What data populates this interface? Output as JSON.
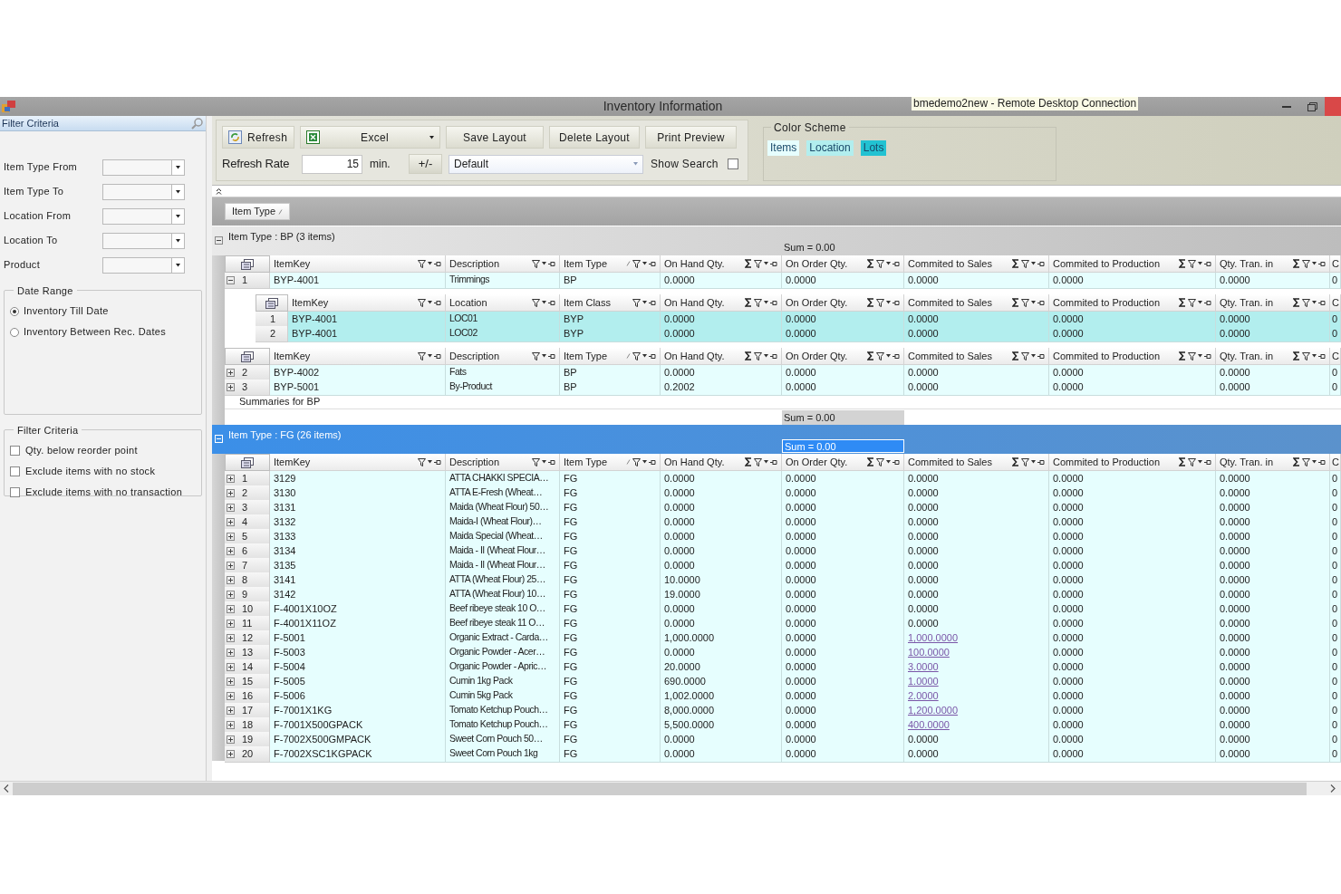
{
  "window": {
    "title": "Inventory Information",
    "remote_title": "bmedemo2new - Remote Desktop Connection"
  },
  "filter_panel": {
    "title": "Filter Criteria",
    "fields": [
      {
        "label": "Item Type From"
      },
      {
        "label": "Item Type To"
      },
      {
        "label": "Location From"
      },
      {
        "label": "Location To"
      },
      {
        "label": "Product"
      }
    ],
    "date_range": {
      "title": "Date Range",
      "options": [
        {
          "label": "Inventory Till Date",
          "selected": true
        },
        {
          "label": "Inventory Between Rec. Dates",
          "selected": false
        }
      ]
    },
    "criteria": {
      "title": "Filter Criteria",
      "options": [
        {
          "label": "Qty. below reorder point",
          "checked": false
        },
        {
          "label": "Exclude items with no stock",
          "checked": false
        },
        {
          "label": "Exclude items with no transaction",
          "checked": false
        }
      ]
    }
  },
  "toolbar": {
    "refresh": "Refresh",
    "excel": "Excel",
    "save_layout": "Save Layout",
    "delete_layout": "Delete Layout",
    "print_preview": "Print Preview",
    "refresh_rate": {
      "label": "Refresh Rate",
      "value": "15",
      "unit": "min."
    },
    "adjust": "+/-",
    "layout": "Default",
    "show_search": {
      "label": "Show Search",
      "checked": false
    }
  },
  "color_scheme": {
    "title": "Color Scheme",
    "items": [
      {
        "label": "Items",
        "color": "#e6fefe"
      },
      {
        "label": "Location",
        "color": "#b2eeee"
      },
      {
        "label": "Lots",
        "color": "#22c2d2"
      }
    ]
  },
  "group_by": {
    "label": "Item Type",
    "sorted": true
  },
  "groups": [
    {
      "label": "Item Type : BP (3 items)",
      "sum": "Sum = 0.00",
      "expanded": true,
      "selected": false,
      "summary_label": "Summaries for BP",
      "summary_sum": "Sum = 0.00",
      "blocks": [
        {
          "kind": "header",
          "columns": [
            {
              "label": "ItemKey",
              "kind": "text",
              "sorted": false
            },
            {
              "label": "Description",
              "kind": "text",
              "sorted": false
            },
            {
              "label": "Item Type",
              "kind": "text",
              "sorted": true
            },
            {
              "label": "On Hand Qty.",
              "kind": "numeric",
              "sorted": false
            },
            {
              "label": "On Order Qty.",
              "kind": "numeric",
              "sorted": false
            },
            {
              "label": "Commited to Sales",
              "kind": "numeric",
              "sorted": false
            },
            {
              "label": "Commited to Production",
              "kind": "numeric",
              "sorted": false
            },
            {
              "label": "Qty. Tran. in",
              "kind": "numeric",
              "sorted": false
            },
            {
              "label": "C",
              "kind": "partial",
              "sorted": false
            }
          ]
        },
        {
          "kind": "row",
          "number": "1",
          "expanded": true,
          "sales_link": false,
          "cells": [
            "BYP-4001",
            "Trimmings",
            "BP",
            "0.0000",
            "0.0000",
            "0.0000",
            "0.0000",
            "0.0000",
            "0"
          ]
        },
        {
          "kind": "child_table",
          "columns": [
            {
              "label": "ItemKey",
              "kind": "text",
              "sorted": false
            },
            {
              "label": "Location",
              "kind": "text",
              "sorted": false
            },
            {
              "label": "Item Class",
              "kind": "text",
              "sorted": false
            },
            {
              "label": "On Hand Qty.",
              "kind": "numeric",
              "sorted": false
            },
            {
              "label": "On Order Qty.",
              "kind": "numeric",
              "sorted": false
            },
            {
              "label": "Commited to Sales",
              "kind": "numeric",
              "sorted": false
            },
            {
              "label": "Commited to Production",
              "kind": "numeric",
              "sorted": false
            },
            {
              "label": "Qty. Tran. in",
              "kind": "numeric",
              "sorted": false
            },
            {
              "label": "C",
              "kind": "partial",
              "sorted": false
            }
          ],
          "rows": [
            {
              "number": "1",
              "cells": [
                "BYP-4001",
                "LOC01",
                "BYP",
                "0.0000",
                "0.0000",
                "0.0000",
                "0.0000",
                "0.0000",
                "0"
              ]
            },
            {
              "number": "2",
              "cells": [
                "BYP-4001",
                "LOC02",
                "BYP",
                "0.0000",
                "0.0000",
                "0.0000",
                "0.0000",
                "0.0000",
                "0"
              ]
            }
          ]
        },
        {
          "kind": "header",
          "columns": [
            {
              "label": "ItemKey",
              "kind": "text",
              "sorted": false
            },
            {
              "label": "Description",
              "kind": "text",
              "sorted": false
            },
            {
              "label": "Item Type",
              "kind": "text",
              "sorted": true
            },
            {
              "label": "On Hand Qty.",
              "kind": "numeric",
              "sorted": false
            },
            {
              "label": "On Order Qty.",
              "kind": "numeric",
              "sorted": false
            },
            {
              "label": "Commited to Sales",
              "kind": "numeric",
              "sorted": false
            },
            {
              "label": "Commited to Production",
              "kind": "numeric",
              "sorted": false
            },
            {
              "label": "Qty. Tran. in",
              "kind": "numeric",
              "sorted": false
            },
            {
              "label": "C",
              "kind": "partial",
              "sorted": false
            }
          ]
        },
        {
          "kind": "row",
          "number": "2",
          "expanded": false,
          "sales_link": false,
          "cells": [
            "BYP-4002",
            "Fats",
            "BP",
            "0.0000",
            "0.0000",
            "0.0000",
            "0.0000",
            "0.0000",
            "0"
          ]
        },
        {
          "kind": "row",
          "number": "3",
          "expanded": false,
          "sales_link": false,
          "cells": [
            "BYP-5001",
            "By-Product",
            "BP",
            "0.2002",
            "0.0000",
            "0.0000",
            "0.0000",
            "0.0000",
            "0"
          ]
        }
      ]
    },
    {
      "label": "Item Type : FG (26 items)",
      "sum": "Sum = 0.00",
      "expanded": true,
      "selected": true,
      "blocks": [
        {
          "kind": "header",
          "columns": [
            {
              "label": "ItemKey",
              "kind": "text",
              "sorted": false
            },
            {
              "label": "Description",
              "kind": "text",
              "sorted": false
            },
            {
              "label": "Item Type",
              "kind": "text",
              "sorted": true
            },
            {
              "label": "On Hand Qty.",
              "kind": "numeric",
              "sorted": false
            },
            {
              "label": "On Order Qty.",
              "kind": "numeric",
              "sorted": false
            },
            {
              "label": "Commited to Sales",
              "kind": "numeric",
              "sorted": false
            },
            {
              "label": "Commited to Production",
              "kind": "numeric",
              "sorted": false
            },
            {
              "label": "Qty. Tran. in",
              "kind": "numeric",
              "sorted": false
            },
            {
              "label": "C",
              "kind": "partial",
              "sorted": false
            }
          ]
        },
        {
          "kind": "row",
          "number": "1",
          "expanded": false,
          "sales_link": false,
          "cells": [
            "3129",
            "ATTA CHAKKI SPECIA…",
            "FG",
            "0.0000",
            "0.0000",
            "0.0000",
            "0.0000",
            "0.0000",
            "0"
          ]
        },
        {
          "kind": "row",
          "number": "2",
          "expanded": false,
          "sales_link": false,
          "cells": [
            "3130",
            "ATTA E-Fresh (Wheat…",
            "FG",
            "0.0000",
            "0.0000",
            "0.0000",
            "0.0000",
            "0.0000",
            "0"
          ]
        },
        {
          "kind": "row",
          "number": "3",
          "expanded": false,
          "sales_link": false,
          "cells": [
            "3131",
            "Maida (Wheat Flour) 50…",
            "FG",
            "0.0000",
            "0.0000",
            "0.0000",
            "0.0000",
            "0.0000",
            "0"
          ]
        },
        {
          "kind": "row",
          "number": "4",
          "expanded": false,
          "sales_link": false,
          "cells": [
            "3132",
            "Maida-I (Wheat Flour)…",
            "FG",
            "0.0000",
            "0.0000",
            "0.0000",
            "0.0000",
            "0.0000",
            "0"
          ]
        },
        {
          "kind": "row",
          "number": "5",
          "expanded": false,
          "sales_link": false,
          "cells": [
            "3133",
            "Maida Special (Wheat…",
            "FG",
            "0.0000",
            "0.0000",
            "0.0000",
            "0.0000",
            "0.0000",
            "0"
          ]
        },
        {
          "kind": "row",
          "number": "6",
          "expanded": false,
          "sales_link": false,
          "cells": [
            "3134",
            "Maida - II (Wheat Flour…",
            "FG",
            "0.0000",
            "0.0000",
            "0.0000",
            "0.0000",
            "0.0000",
            "0"
          ]
        },
        {
          "kind": "row",
          "number": "7",
          "expanded": false,
          "sales_link": false,
          "cells": [
            "3135",
            "Maida - II (Wheat Flour…",
            "FG",
            "0.0000",
            "0.0000",
            "0.0000",
            "0.0000",
            "0.0000",
            "0"
          ]
        },
        {
          "kind": "row",
          "number": "8",
          "expanded": false,
          "sales_link": false,
          "cells": [
            "3141",
            "ATTA (Wheat Flour) 25…",
            "FG",
            "10.0000",
            "0.0000",
            "0.0000",
            "0.0000",
            "0.0000",
            "0"
          ]
        },
        {
          "kind": "row",
          "number": "9",
          "expanded": false,
          "sales_link": false,
          "cells": [
            "3142",
            "ATTA (Wheat Flour) 10…",
            "FG",
            "19.0000",
            "0.0000",
            "0.0000",
            "0.0000",
            "0.0000",
            "0"
          ]
        },
        {
          "kind": "row",
          "number": "10",
          "expanded": false,
          "sales_link": false,
          "cells": [
            "F-4001X10OZ",
            "Beef ribeye steak 10 O…",
            "FG",
            "0.0000",
            "0.0000",
            "0.0000",
            "0.0000",
            "0.0000",
            "0"
          ]
        },
        {
          "kind": "row",
          "number": "11",
          "expanded": false,
          "sales_link": false,
          "cells": [
            "F-4001X11OZ",
            "Beef ribeye steak 11 O…",
            "FG",
            "0.0000",
            "0.0000",
            "0.0000",
            "0.0000",
            "0.0000",
            "0"
          ]
        },
        {
          "kind": "row",
          "number": "12",
          "expanded": false,
          "sales_link": true,
          "cells": [
            "F-5001",
            "Organic Extract - Carda…",
            "FG",
            "1,000.0000",
            "0.0000",
            "1,000.0000",
            "0.0000",
            "0.0000",
            "0"
          ]
        },
        {
          "kind": "row",
          "number": "13",
          "expanded": false,
          "sales_link": true,
          "cells": [
            "F-5003",
            "Organic Powder - Acer…",
            "FG",
            "0.0000",
            "0.0000",
            "100.0000",
            "0.0000",
            "0.0000",
            "0"
          ]
        },
        {
          "kind": "row",
          "number": "14",
          "expanded": false,
          "sales_link": true,
          "cells": [
            "F-5004",
            "Organic Powder - Apric…",
            "FG",
            "20.0000",
            "0.0000",
            "3.0000",
            "0.0000",
            "0.0000",
            "0"
          ]
        },
        {
          "kind": "row",
          "number": "15",
          "expanded": false,
          "sales_link": true,
          "cells": [
            "F-5005",
            "Cumin 1kg Pack",
            "FG",
            "690.0000",
            "0.0000",
            "1.0000",
            "0.0000",
            "0.0000",
            "0"
          ]
        },
        {
          "kind": "row",
          "number": "16",
          "expanded": false,
          "sales_link": true,
          "cells": [
            "F-5006",
            "Cumin 5kg Pack",
            "FG",
            "1,002.0000",
            "0.0000",
            "2.0000",
            "0.0000",
            "0.0000",
            "0"
          ]
        },
        {
          "kind": "row",
          "number": "17",
          "expanded": false,
          "sales_link": true,
          "cells": [
            "F-7001X1KG",
            "Tomato Ketchup Pouch…",
            "FG",
            "8,000.0000",
            "0.0000",
            "1,200.0000",
            "0.0000",
            "0.0000",
            "0"
          ]
        },
        {
          "kind": "row",
          "number": "18",
          "expanded": false,
          "sales_link": true,
          "cells": [
            "F-7001X500GPACK",
            "Tomato Ketchup Pouch…",
            "FG",
            "5,500.0000",
            "0.0000",
            "400.0000",
            "0.0000",
            "0.0000",
            "0"
          ]
        },
        {
          "kind": "row",
          "number": "19",
          "expanded": false,
          "sales_link": false,
          "cells": [
            "F-7002X500GMPACK",
            "Sweet Corn  Pouch 50…",
            "FG",
            "0.0000",
            "0.0000",
            "0.0000",
            "0.0000",
            "0.0000",
            "0"
          ]
        },
        {
          "kind": "row",
          "number": "20",
          "expanded": false,
          "sales_link": false,
          "cells": [
            "F-7002XSC1KGPACK",
            "Sweet Corn  Pouch 1kg",
            "FG",
            "0.0000",
            "0.0000",
            "0.0000",
            "0.0000",
            "0.0000",
            "0"
          ]
        }
      ]
    }
  ]
}
